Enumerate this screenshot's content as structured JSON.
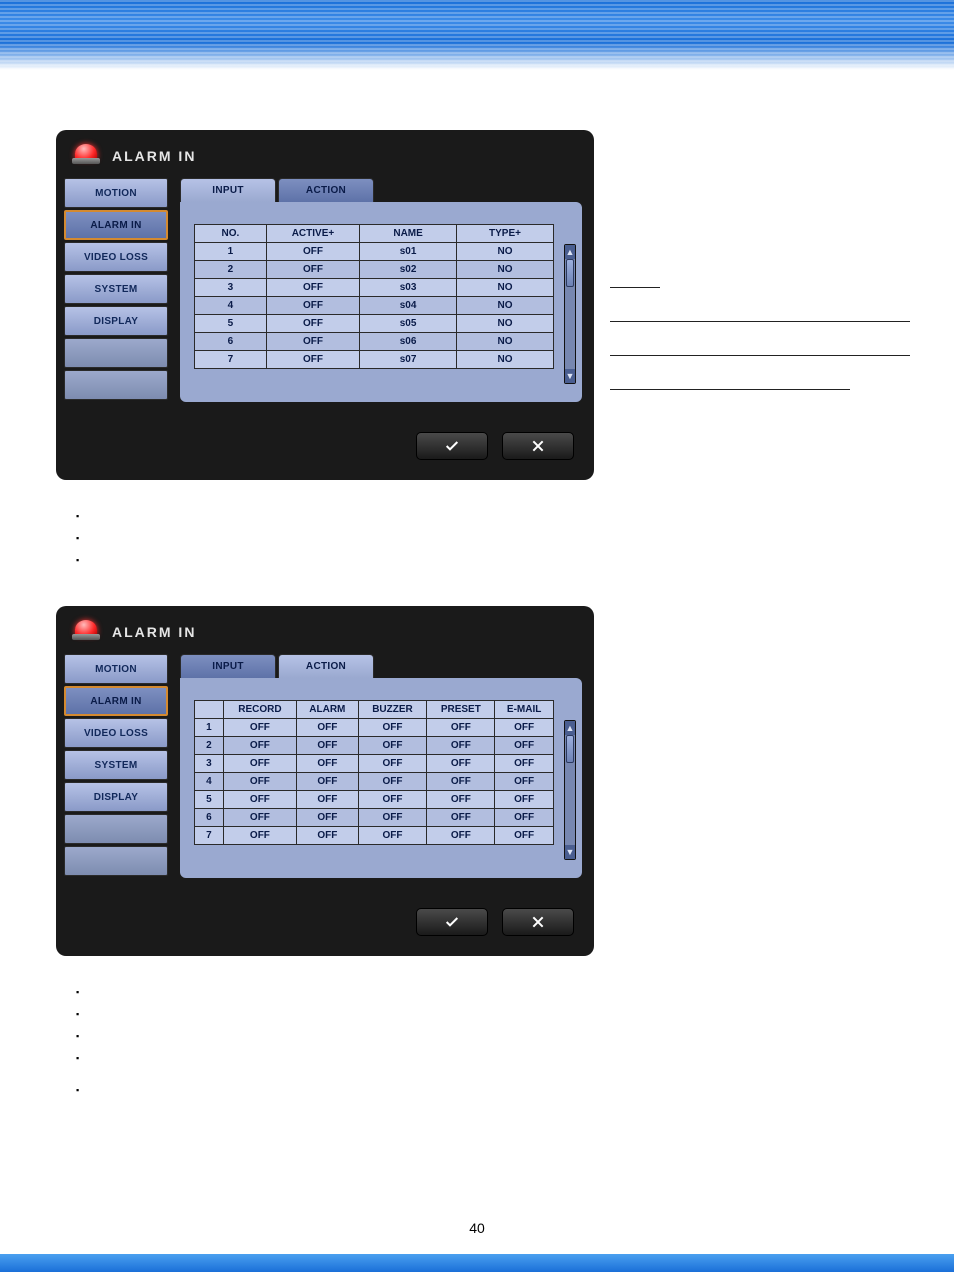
{
  "page_number": "40",
  "panel1": {
    "title": "ALARM IN",
    "sidebar": {
      "items": [
        "MOTION",
        "ALARM IN",
        "VIDEO LOSS",
        "SYSTEM",
        "DISPLAY"
      ],
      "selected_index": 1
    },
    "tabs": [
      "INPUT",
      "ACTION"
    ],
    "active_tab": 0,
    "headers": [
      "NO.",
      "ACTIVE+",
      "NAME",
      "TYPE+"
    ],
    "rows": [
      [
        "1",
        "OFF",
        "s01",
        "NO"
      ],
      [
        "2",
        "OFF",
        "s02",
        "NO"
      ],
      [
        "3",
        "OFF",
        "s03",
        "NO"
      ],
      [
        "4",
        "OFF",
        "s04",
        "NO"
      ],
      [
        "5",
        "OFF",
        "s05",
        "NO"
      ],
      [
        "6",
        "OFF",
        "s06",
        "NO"
      ],
      [
        "7",
        "OFF",
        "s07",
        "NO"
      ]
    ]
  },
  "panel2": {
    "title": "ALARM IN",
    "sidebar": {
      "items": [
        "MOTION",
        "ALARM IN",
        "VIDEO LOSS",
        "SYSTEM",
        "DISPLAY"
      ],
      "selected_index": 1
    },
    "tabs": [
      "INPUT",
      "ACTION"
    ],
    "active_tab": 1,
    "headers": [
      "",
      "RECORD",
      "ALARM",
      "BUZZER",
      "PRESET",
      "E-MAIL"
    ],
    "rows": [
      [
        "1",
        "OFF",
        "OFF",
        "OFF",
        "OFF",
        "OFF"
      ],
      [
        "2",
        "OFF",
        "OFF",
        "OFF",
        "OFF",
        "OFF"
      ],
      [
        "3",
        "OFF",
        "OFF",
        "OFF",
        "OFF",
        "OFF"
      ],
      [
        "4",
        "OFF",
        "OFF",
        "OFF",
        "OFF",
        "OFF"
      ],
      [
        "5",
        "OFF",
        "OFF",
        "OFF",
        "OFF",
        "OFF"
      ],
      [
        "6",
        "OFF",
        "OFF",
        "OFF",
        "OFF",
        "OFF"
      ],
      [
        "7",
        "OFF",
        "OFF",
        "OFF",
        "OFF",
        "OFF"
      ]
    ]
  }
}
